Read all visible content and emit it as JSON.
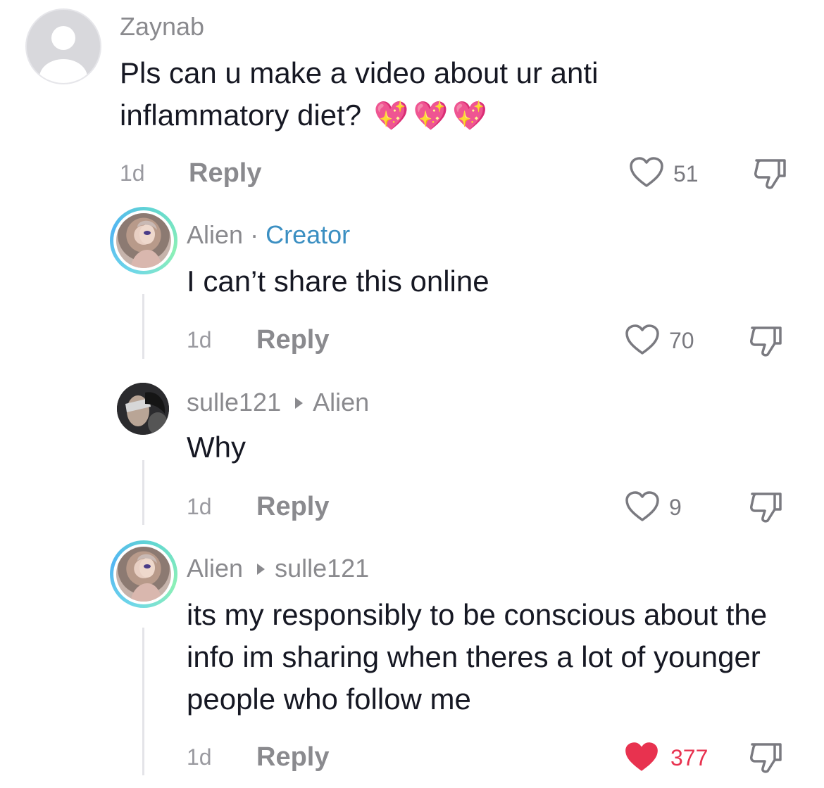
{
  "comments": [
    {
      "username": "Zaynab",
      "text": "Pls can u make a video about ur anti inflammatory diet?",
      "emoji": "💖💖💖",
      "time": "1d",
      "reply_label": "Reply",
      "likes": "51",
      "liked": false
    }
  ],
  "replies": [
    {
      "username": "Alien",
      "separator": "·",
      "badge": "Creator",
      "text": "I can’t share this online",
      "time": "1d",
      "reply_label": "Reply",
      "likes": "70",
      "liked": false
    },
    {
      "username": "sulle121",
      "reply_to": "Alien",
      "text": "Why",
      "time": "1d",
      "reply_label": "Reply",
      "likes": "9",
      "liked": false
    },
    {
      "username": "Alien",
      "reply_to": "sulle121",
      "text": "its my responsibly to be conscious about the info im sharing when theres a lot of younger people who follow me",
      "time": "1d",
      "reply_label": "Reply",
      "likes": "377",
      "liked": true
    }
  ],
  "colors": {
    "liked_heart": "#e8324f",
    "creator_badge": "#3b8fc2",
    "ring_gradient": [
      "#53b6f2",
      "#8cf0b6"
    ]
  },
  "icons": {
    "like": "heart-icon",
    "dislike": "thumbs-down-icon",
    "reply_arrow": "caret-right-icon"
  }
}
